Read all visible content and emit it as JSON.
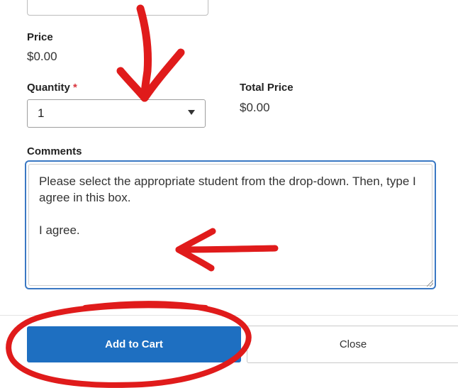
{
  "price": {
    "label": "Price",
    "value": "$0.00"
  },
  "quantity": {
    "label": "Quantity",
    "required_mark": "*",
    "selected": "1"
  },
  "total_price": {
    "label": "Total Price",
    "value": "$0.00"
  },
  "comments": {
    "label": "Comments",
    "value": "Please select the appropriate student from the drop-down. Then, type I agree in this box.\n\nI agree."
  },
  "actions": {
    "add_to_cart": "Add to Cart",
    "close": "Close"
  },
  "colors": {
    "primary": "#1e6fc1",
    "annotation": "#e01b1b",
    "focus_border": "#3a78c3"
  }
}
